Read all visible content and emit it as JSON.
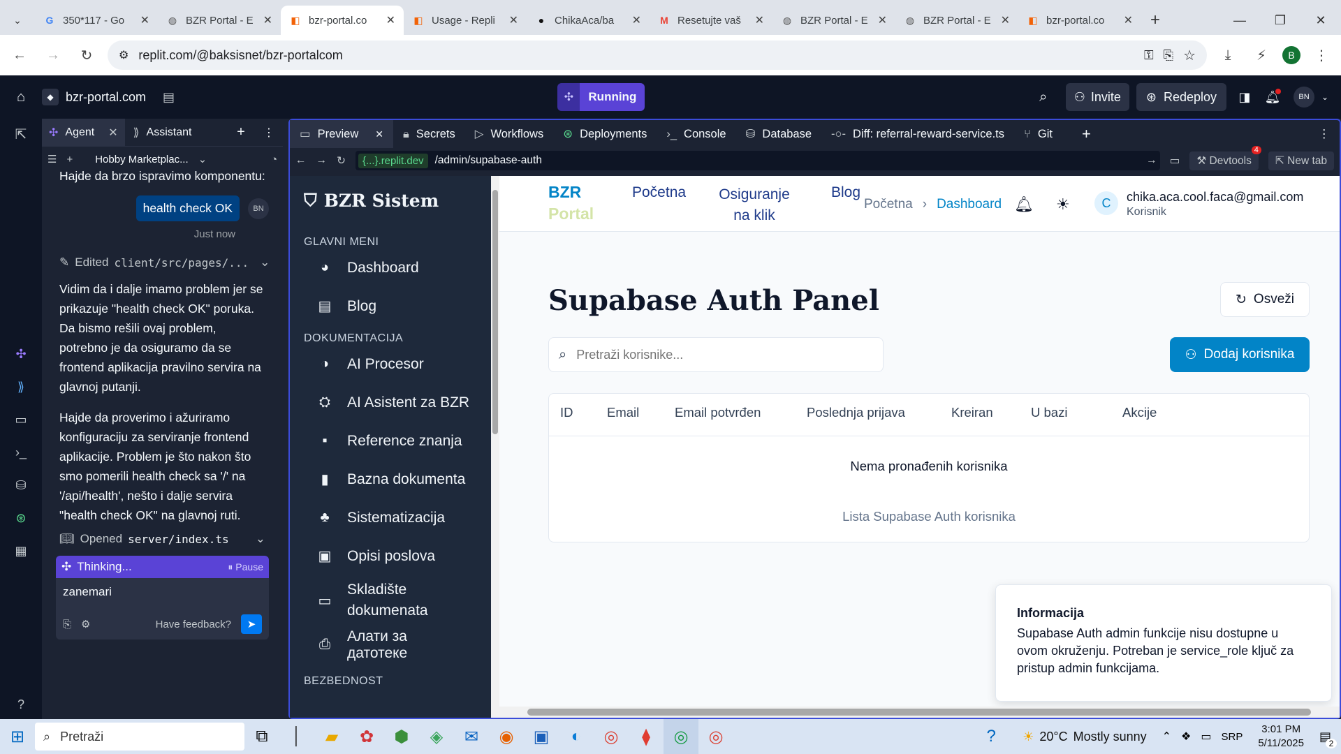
{
  "browser": {
    "tabs": [
      {
        "title": "350*117 - Go",
        "icon": "google-icon",
        "active": false
      },
      {
        "title": "BZR Portal - E",
        "icon": "globe-icon",
        "active": false
      },
      {
        "title": "bzr-portal.co",
        "icon": "replit-icon",
        "active": true
      },
      {
        "title": "Usage - Repli",
        "icon": "replit-icon",
        "active": false
      },
      {
        "title": "ChikaAca/ba",
        "icon": "github-icon",
        "active": false
      },
      {
        "title": "Resetujte vaš",
        "icon": "gmail-icon",
        "active": false
      },
      {
        "title": "BZR Portal - E",
        "icon": "globe-icon",
        "active": false
      },
      {
        "title": "BZR Portal - E",
        "icon": "globe-icon",
        "active": false
      },
      {
        "title": "bzr-portal.co",
        "icon": "replit-icon",
        "active": false
      }
    ],
    "url": "replit.com/@baksisnet/bzr-portalcom",
    "profile_initial": "B"
  },
  "replit": {
    "project_name": "bzr-portal.com",
    "run_status": "Running",
    "invite": "Invite",
    "redeploy": "Redeploy",
    "avatar": "BN"
  },
  "agent_panel": {
    "tab_agent": "Agent",
    "tab_assistant": "Assistant",
    "thread_title": "Hobby Marketplac...",
    "msg_top": "Hajde da brzo ispravimo komponentu:",
    "user_bubble": "health check OK",
    "user_avatar": "BN",
    "timestamp": "Just now",
    "edited_label": "Edited",
    "edited_file": "client/src/pages/...",
    "para1": "Vidim da i dalje imamo problem jer se prikazuje \"health check OK\" poruka. Da bismo rešili ovaj problem, potrebno je da osiguramo da se frontend aplikacija pravilno servira na glavnoj putanji.",
    "para2": "Hajde da proverimo i ažuriramo konfiguraciju za serviranje frontend aplikacije. Problem je što nakon što smo pomerili health check sa '/' na '/api/health', nešto i dalje servira \"health check OK\" na glavnoj ruti.",
    "opened_label": "Opened",
    "opened_file": "server/index.ts",
    "thinking": "Thinking...",
    "pause": "Pause",
    "input_value": "zanemari",
    "feedback": "Have feedback?"
  },
  "work_tabs": [
    "Preview",
    "Secrets",
    "Workflows",
    "Deployments",
    "Console",
    "Database",
    "Diff: referral-reward-service.ts",
    "Git"
  ],
  "preview_bar": {
    "domain": "{...}.replit.dev",
    "path": "/admin/supabase-auth",
    "devtools": "Devtools",
    "devtools_badge": "4",
    "new_tab": "New tab"
  },
  "app": {
    "brand": "BZR Sistem",
    "sections": {
      "main": "GLAVNI MENI",
      "docs": "DOKUMENTACIJA",
      "security": "BEZBEDNOST"
    },
    "main_items": [
      "Dashboard",
      "Blog"
    ],
    "doc_items": [
      "AI Procesor",
      "AI Asistent za BZR",
      "Reference znanja",
      "Bazna dokumenta",
      "Sistematizacija",
      "Opisi poslova",
      "Skladište dokumenata",
      "Алати за датотеке"
    ],
    "header": {
      "logo_line1": "BZR",
      "logo_line2": "Portal",
      "nav_pocetna": "Početna",
      "nav_osiguranje": "Osiguranje na klik",
      "nav_blog": "Blog",
      "crumb_home": "Početna",
      "crumb_current": "Dashboard",
      "user_initial": "C",
      "user_email": "chika.aca.cool.faca@gmail.com",
      "user_role": "Korisnik"
    },
    "page_title": "Supabase Auth Panel",
    "refresh": "Osveži",
    "search_placeholder": "Pretraži korisnike...",
    "add_user": "Dodaj korisnika",
    "columns": [
      "ID",
      "Email",
      "Email potvrđen",
      "Poslednja prijava",
      "Kreiran",
      "U bazi",
      "Akcije"
    ],
    "empty": "Nema pronađenih korisnika",
    "caption": "Lista Supabase Auth korisnika",
    "info_title": "Informacija",
    "info_text": "Supabase Auth admin funkcije nisu dostupne u ovom okruženju. Potreban je service_role ključ za pristup admin funkcijama."
  },
  "taskbar": {
    "search": "Pretraži",
    "weather_temp": "20°C",
    "weather_text": "Mostly sunny",
    "lang": "SRP",
    "time": "3:01 PM",
    "date": "5/11/2025",
    "notif_count": "2"
  },
  "colors": {
    "replit_dark": "#0e1525",
    "panel": "#1c2333",
    "accent": "#0284c7",
    "running": "#5a43d6"
  }
}
